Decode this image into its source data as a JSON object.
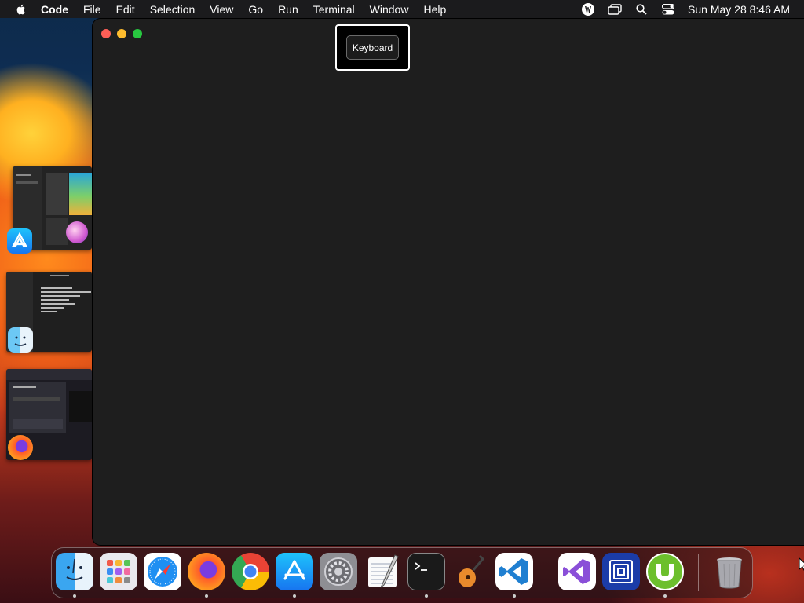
{
  "menubar": {
    "app_name": "Code",
    "items": [
      "File",
      "Edit",
      "Selection",
      "View",
      "Go",
      "Run",
      "Terminal",
      "Window",
      "Help"
    ],
    "status_icons": [
      "vpn-icon",
      "screen-mirror-icon",
      "spotlight-search-icon",
      "control-center-icon"
    ],
    "clock": "Sun May 28  8:46 AM"
  },
  "window": {
    "title": "",
    "keyboard_button": "Keyboard"
  },
  "stage_manager": {
    "groups": [
      {
        "app": "App Store",
        "icon": "app-store-icon"
      },
      {
        "app": "Finder",
        "icon": "finder-icon"
      },
      {
        "app": "Firefox",
        "icon": "firefox-icon"
      }
    ]
  },
  "dock": {
    "apps": [
      {
        "name": "Finder",
        "icon": "finder-icon",
        "running": true
      },
      {
        "name": "Launchpad",
        "icon": "launchpad-icon",
        "running": false
      },
      {
        "name": "Safari",
        "icon": "safari-icon",
        "running": false
      },
      {
        "name": "Firefox",
        "icon": "firefox-icon",
        "running": true
      },
      {
        "name": "Google Chrome",
        "icon": "chrome-icon",
        "running": false
      },
      {
        "name": "App Store",
        "icon": "app-store-icon",
        "running": true
      },
      {
        "name": "System Settings",
        "icon": "system-settings-icon",
        "running": false
      },
      {
        "name": "TextEdit",
        "icon": "textedit-icon",
        "running": false
      },
      {
        "name": "Terminal",
        "icon": "terminal-icon",
        "running": true
      },
      {
        "name": "GarageBand",
        "icon": "garageband-icon",
        "running": false
      },
      {
        "name": "Visual Studio Code",
        "icon": "vscode-icon",
        "running": true
      },
      {
        "name": "Visual Studio",
        "icon": "visual-studio-icon",
        "running": false
      },
      {
        "name": "Simulator",
        "icon": "simulator-icon",
        "running": false
      },
      {
        "name": "uTorrent",
        "icon": "utorrent-icon",
        "running": true
      },
      {
        "name": "Trash",
        "icon": "trash-icon",
        "running": false
      }
    ]
  }
}
